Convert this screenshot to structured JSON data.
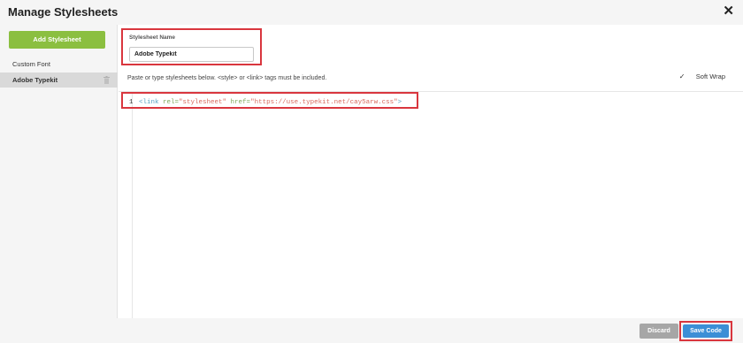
{
  "dialog": {
    "title": "Manage Stylesheets",
    "close_glyph": "✕"
  },
  "sidebar": {
    "add_label": "Add Stylesheet",
    "items": [
      {
        "label": "Custom Font"
      },
      {
        "label": "Adobe Typekit"
      }
    ]
  },
  "form": {
    "name_label": "Stylesheet Name",
    "name_value": "Adobe Typekit",
    "hint": "Paste or type stylesheets below. <style> or <link> tags must be included.",
    "softwrap_label": "Soft Wrap",
    "softwrap_checked": "✓"
  },
  "editor": {
    "line_number": "1",
    "tag_open": "<link ",
    "attr_rel": "rel=",
    "val_rel": "\"stylesheet\"",
    "attr_href": " href=",
    "val_href": "\"https://use.typekit.net/cay5arw.css\"",
    "tag_close": ">"
  },
  "footer": {
    "discard_label": "Discard",
    "save_label": "Save Code"
  },
  "colors": {
    "add_button": "#8bbf40",
    "save_button": "#3c8fd6",
    "discard_button": "#a6a6a6",
    "highlight_border": "#d9363e"
  },
  "icons": [
    "close-icon",
    "trash-icon",
    "checkbox-icon"
  ]
}
